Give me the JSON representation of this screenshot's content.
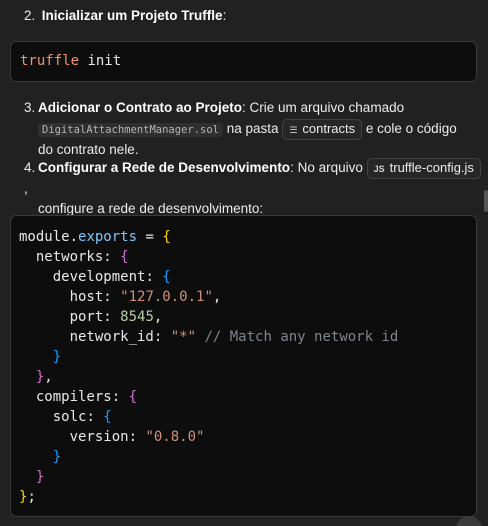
{
  "step2": {
    "num": "2.",
    "title": "Inicializar um Projeto Truffle",
    "tail": ":"
  },
  "code1": {
    "kw": "truffle",
    "rest": " init"
  },
  "step3": {
    "num": "3.",
    "title": "Adicionar o Contrato ao Projeto",
    "text_a": ": Crie um arquivo chamado",
    "file": "DigitalAttachmentManager.sol",
    "text_b": " na pasta ",
    "folder": "contracts",
    "folder_icon": "folder-lines-icon",
    "text_c": " e cole o código",
    "text_d": "do contrato nele."
  },
  "step4": {
    "num": "4.",
    "title": "Configurar a Rede de Desenvolvimento",
    "text_a": ": No arquivo ",
    "file": "truffle-config.js",
    "file_icon": "JS",
    "text_b": " ,",
    "text_c": "configure a rede de desenvolvimento:"
  },
  "code2": {
    "l1": {
      "a": "module",
      "b": ".",
      "c": "exports",
      "d": " = ",
      "e": "{"
    },
    "l2": {
      "a": "networks",
      "b": ": ",
      "c": "{"
    },
    "l3": {
      "a": "development",
      "b": ": ",
      "c": "{"
    },
    "l4": {
      "a": "host",
      "b": ": ",
      "c": "\"127.0.0.1\"",
      "d": ","
    },
    "l5": {
      "a": "port",
      "b": ": ",
      "c": "8545",
      "d": ","
    },
    "l6": {
      "a": "network_id",
      "b": ": ",
      "c": "\"*\"",
      "d": " // Match any network id"
    },
    "l7": {
      "a": "}"
    },
    "l8": {
      "a": "}",
      "b": ","
    },
    "l9": {
      "a": "compilers",
      "b": ": ",
      "c": "{"
    },
    "l10": {
      "a": "solc",
      "b": ": ",
      "c": "{"
    },
    "l11": {
      "a": "version",
      "b": ": ",
      "c": "\"0.8.0\""
    },
    "l12": {
      "a": "}"
    },
    "l13": {
      "a": "}"
    },
    "l14": {
      "a": "}",
      "b": ";"
    }
  }
}
